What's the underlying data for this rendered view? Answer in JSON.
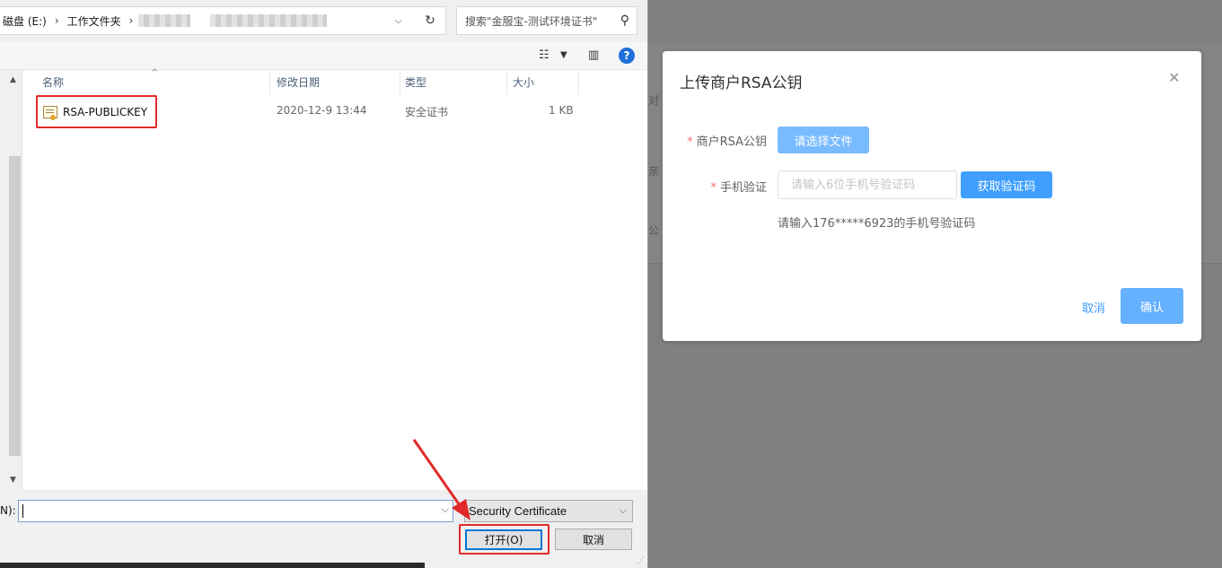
{
  "file_dialog": {
    "breadcrumb": [
      "磁盘 (E:)",
      "工作文件夹"
    ],
    "search_placeholder": "搜索\"金服宝-测试环境证书\"",
    "columns": [
      "名称",
      "修改日期",
      "类型",
      "大小"
    ],
    "files": [
      {
        "name": "RSA-PUBLICKEY",
        "modified": "2020-12-9 13:44",
        "type": "安全证书",
        "size": "1 KB"
      }
    ],
    "filename_label": "N):",
    "filename_value": "",
    "file_type": "Security Certificate",
    "open_label": "打开(O)",
    "cancel_label": "取消"
  },
  "modal": {
    "title": "上传商户RSA公钥",
    "rsa_label": "商户RSA公钥",
    "choose_file_label": "请选择文件",
    "phone_label": "手机验证",
    "sms_placeholder": "请输入6位手机号验证码",
    "get_code_label": "获取验证码",
    "hint": "请输入176*****6923的手机号验证码",
    "cancel_label": "取消",
    "confirm_label": "确认"
  },
  "background": {
    "fragments": [
      "对",
      "亲",
      "公"
    ]
  },
  "colors": {
    "primary": "#409eff",
    "primary_light": "#79bbff",
    "annotation_red": "#e02a2a",
    "required": "#f56c6c"
  }
}
